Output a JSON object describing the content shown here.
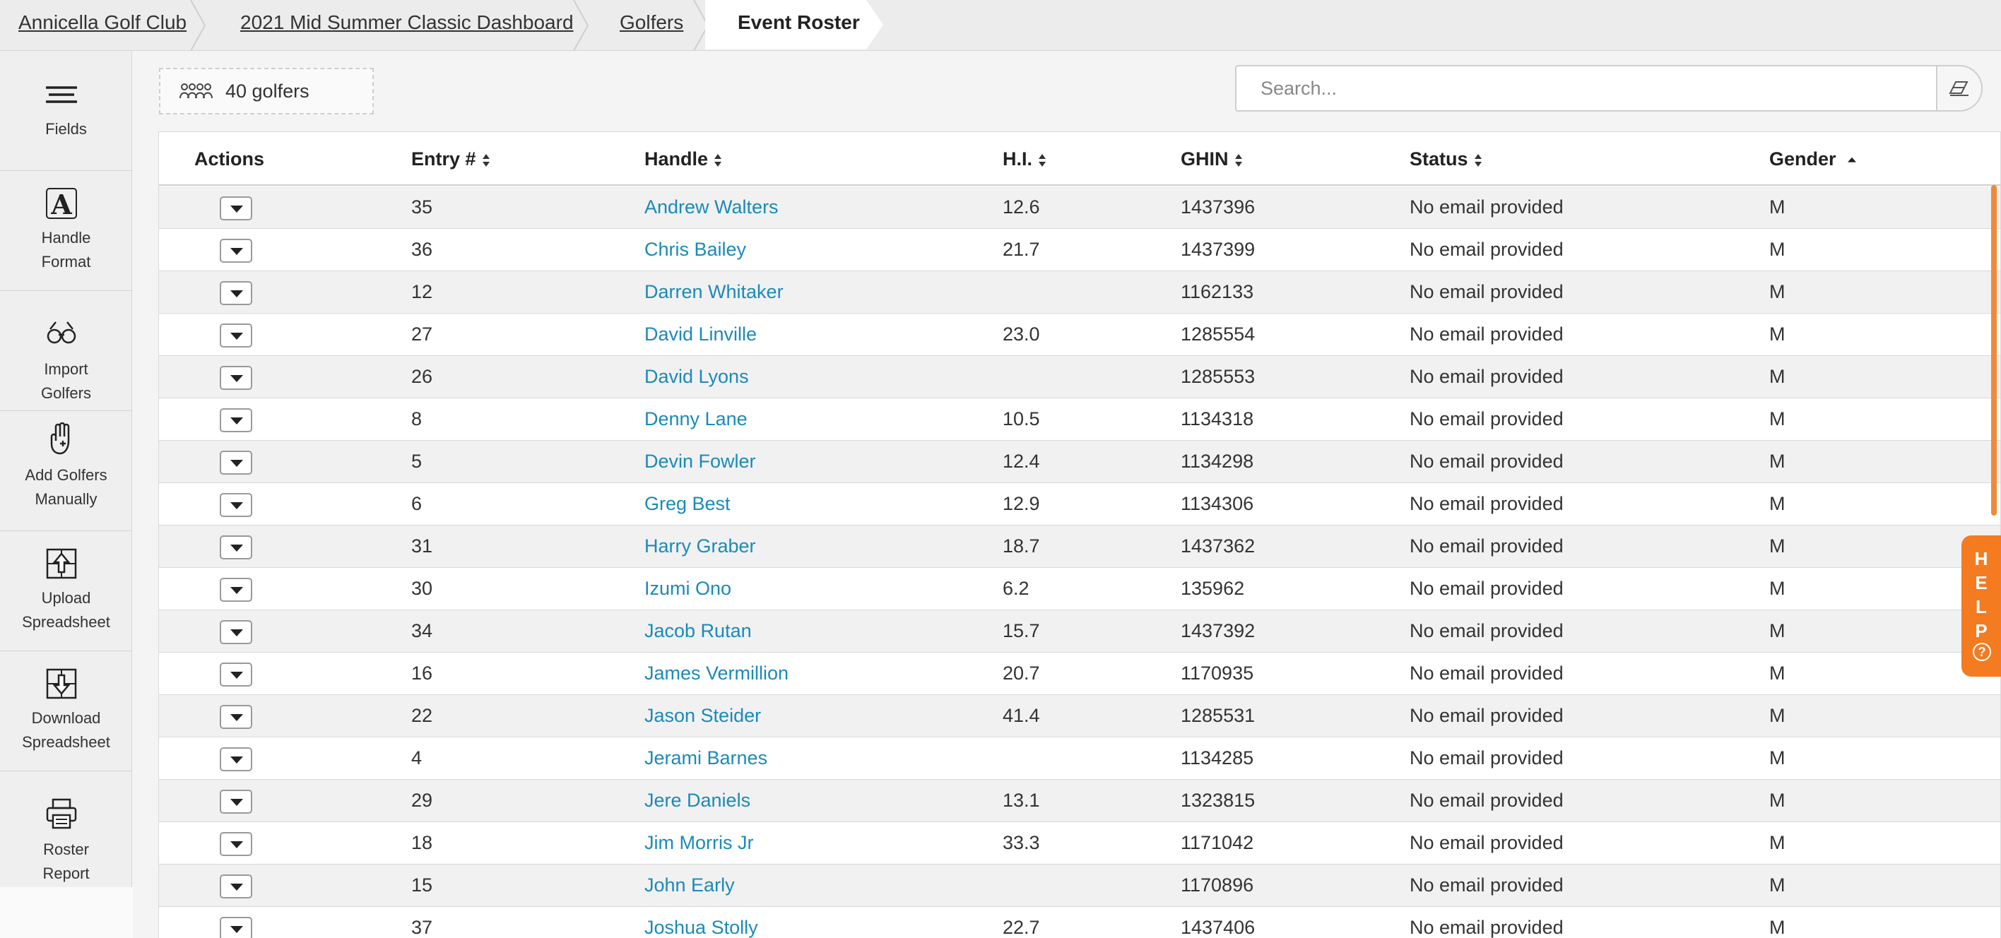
{
  "breadcrumb": {
    "items": [
      "Annicella Golf Club",
      "2021 Mid Summer Classic Dashboard",
      "Golfers"
    ],
    "active": "Event Roster"
  },
  "sidebar": {
    "items": [
      {
        "label_lines": [
          "Fields"
        ],
        "icon": "fields-icon"
      },
      {
        "label_lines": [
          "Handle",
          "Format"
        ],
        "icon": "handle-format-icon"
      },
      {
        "label_lines": [
          "Import",
          "Golfers"
        ],
        "icon": "import-golfers-icon"
      },
      {
        "label_lines": [
          "Add Golfers",
          "Manually"
        ],
        "icon": "add-golfers-icon"
      },
      {
        "label_lines": [
          "Upload",
          "Spreadsheet"
        ],
        "icon": "upload-spreadsheet-icon"
      },
      {
        "label_lines": [
          "Download",
          "Spreadsheet"
        ],
        "icon": "download-spreadsheet-icon"
      },
      {
        "label_lines": [
          "Roster",
          "Report"
        ],
        "icon": "roster-report-icon"
      }
    ]
  },
  "roster": {
    "count_label": "40 golfers",
    "search_placeholder": "Search..."
  },
  "table": {
    "columns": [
      "Actions",
      "Entry #",
      "Handle",
      "H.I.",
      "GHIN",
      "Status",
      "Gender"
    ],
    "sorted_column": "Gender",
    "sort_direction": "ascending",
    "rows": [
      {
        "entry": "35",
        "handle": "Andrew Walters",
        "hi": "12.6",
        "ghin": "1437396",
        "status": "No email provided",
        "gender": "M"
      },
      {
        "entry": "36",
        "handle": "Chris Bailey",
        "hi": "21.7",
        "ghin": "1437399",
        "status": "No email provided",
        "gender": "M"
      },
      {
        "entry": "12",
        "handle": "Darren Whitaker",
        "hi": "",
        "ghin": "1162133",
        "status": "No email provided",
        "gender": "M"
      },
      {
        "entry": "27",
        "handle": "David Linville",
        "hi": "23.0",
        "ghin": "1285554",
        "status": "No email provided",
        "gender": "M"
      },
      {
        "entry": "26",
        "handle": "David Lyons",
        "hi": "",
        "ghin": "1285553",
        "status": "No email provided",
        "gender": "M"
      },
      {
        "entry": "8",
        "handle": "Denny Lane",
        "hi": "10.5",
        "ghin": "1134318",
        "status": "No email provided",
        "gender": "M"
      },
      {
        "entry": "5",
        "handle": "Devin Fowler",
        "hi": "12.4",
        "ghin": "1134298",
        "status": "No email provided",
        "gender": "M"
      },
      {
        "entry": "6",
        "handle": "Greg Best",
        "hi": "12.9",
        "ghin": "1134306",
        "status": "No email provided",
        "gender": "M"
      },
      {
        "entry": "31",
        "handle": "Harry Graber",
        "hi": "18.7",
        "ghin": "1437362",
        "status": "No email provided",
        "gender": "M"
      },
      {
        "entry": "30",
        "handle": "Izumi Ono",
        "hi": "6.2",
        "ghin": "135962",
        "status": "No email provided",
        "gender": "M"
      },
      {
        "entry": "34",
        "handle": "Jacob Rutan",
        "hi": "15.7",
        "ghin": "1437392",
        "status": "No email provided",
        "gender": "M"
      },
      {
        "entry": "16",
        "handle": "James Vermillion",
        "hi": "20.7",
        "ghin": "1170935",
        "status": "No email provided",
        "gender": "M"
      },
      {
        "entry": "22",
        "handle": "Jason Steider",
        "hi": "41.4",
        "ghin": "1285531",
        "status": "No email provided",
        "gender": "M"
      },
      {
        "entry": "4",
        "handle": "Jerami Barnes",
        "hi": "",
        "ghin": "1134285",
        "status": "No email provided",
        "gender": "M"
      },
      {
        "entry": "29",
        "handle": "Jere Daniels",
        "hi": "13.1",
        "ghin": "1323815",
        "status": "No email provided",
        "gender": "M"
      },
      {
        "entry": "18",
        "handle": "Jim Morris Jr",
        "hi": "33.3",
        "ghin": "1171042",
        "status": "No email provided",
        "gender": "M"
      },
      {
        "entry": "15",
        "handle": "John Early",
        "hi": "",
        "ghin": "1170896",
        "status": "No email provided",
        "gender": "M"
      },
      {
        "entry": "37",
        "handle": "Joshua Stolly",
        "hi": "22.7",
        "ghin": "1437406",
        "status": "No email provided",
        "gender": "M"
      }
    ]
  },
  "help": {
    "letters": [
      "H",
      "E",
      "L",
      "P"
    ],
    "icon": "question-circle-icon"
  },
  "colors": {
    "link": "#1b8ab8",
    "accent": "#f47b20",
    "row_alt": "#f1f1f1"
  }
}
